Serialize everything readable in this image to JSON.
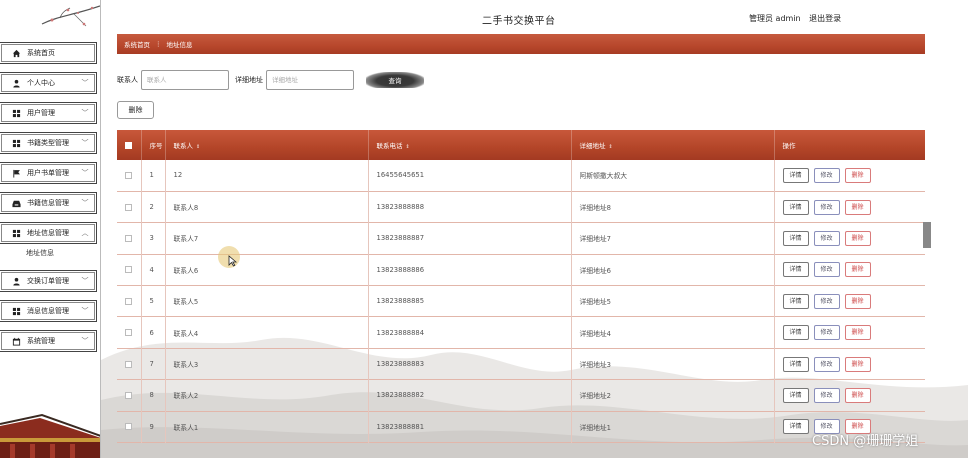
{
  "header": {
    "site_title": "二手书交换平台",
    "user_label": "管理员 admin",
    "logout_label": "退出登录"
  },
  "sidebar": {
    "items": [
      {
        "label": "系统首页",
        "icon": "home-icon",
        "has_chevron": false
      },
      {
        "label": "个人中心",
        "icon": "person-icon",
        "has_chevron": true
      },
      {
        "label": "用户管理",
        "icon": "grid-icon",
        "has_chevron": true
      },
      {
        "label": "书籍类型管理",
        "icon": "grid-icon",
        "has_chevron": true
      },
      {
        "label": "用户书单管理",
        "icon": "flag-icon",
        "has_chevron": true
      },
      {
        "label": "书籍信息管理",
        "icon": "inbox-icon",
        "has_chevron": true
      },
      {
        "label": "地址信息管理",
        "icon": "grid-icon",
        "has_chevron": true,
        "expanded": true
      },
      {
        "label": "交换订单管理",
        "icon": "person-icon",
        "has_chevron": true
      },
      {
        "label": "消息信息管理",
        "icon": "grid-icon",
        "has_chevron": true
      },
      {
        "label": "系统管理",
        "icon": "calendar-icon",
        "has_chevron": true
      }
    ],
    "submenu_label": "地址信息"
  },
  "breadcrumb": {
    "home": "系统首页",
    "separator": "⋮",
    "current": "地址信息"
  },
  "search": {
    "contact_label": "联系人",
    "contact_placeholder": "联系人",
    "address_label": "详细地址",
    "address_placeholder": "详细地址",
    "button_label": "查询"
  },
  "toolbar": {
    "delete_label": "删除"
  },
  "table": {
    "columns": [
      "序号",
      "联系人",
      "联系电话",
      "详细地址",
      "操作"
    ],
    "sort_glyph": "⇕",
    "actions": {
      "detail": "详情",
      "edit": "修改",
      "delete": "删除"
    },
    "rows": [
      {
        "index": "1",
        "contact": "12",
        "phone": "16455645651",
        "address": "阿斯顿撒大叔大"
      },
      {
        "index": "2",
        "contact": "联系人8",
        "phone": "13823888888",
        "address": "详细地址8"
      },
      {
        "index": "3",
        "contact": "联系人7",
        "phone": "13823888887",
        "address": "详细地址7"
      },
      {
        "index": "4",
        "contact": "联系人6",
        "phone": "13823888886",
        "address": "详细地址6"
      },
      {
        "index": "5",
        "contact": "联系人5",
        "phone": "13823888885",
        "address": "详细地址5"
      },
      {
        "index": "6",
        "contact": "联系人4",
        "phone": "13823888884",
        "address": "详细地址4"
      },
      {
        "index": "7",
        "contact": "联系人3",
        "phone": "13823888883",
        "address": "详细地址3"
      },
      {
        "index": "8",
        "contact": "联系人2",
        "phone": "13823888882",
        "address": "详细地址2"
      },
      {
        "index": "9",
        "contact": "联系人1",
        "phone": "13823888881",
        "address": "详细地址1"
      }
    ]
  },
  "watermark": "CSDN @珊珊学姐",
  "colors": {
    "accent": "#b34528",
    "row_border": "#e2b6aa"
  }
}
